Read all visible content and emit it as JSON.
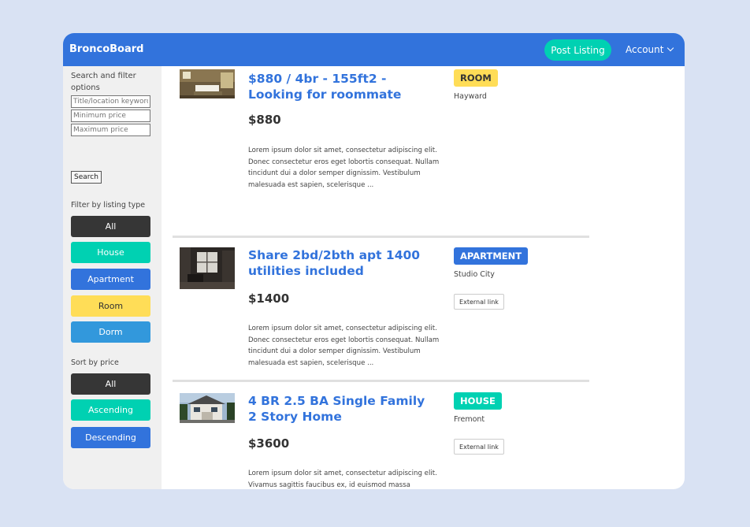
{
  "nav": {
    "brand": "BroncoBoard",
    "post_listing": "Post Listing",
    "account": "Account"
  },
  "sidebar": {
    "search_title": "Search and filter options",
    "title_placeholder": "Title/location keyword",
    "min_placeholder": "Minimum price",
    "max_placeholder": "Maximum price",
    "search_button": "Search",
    "filter_label": "Filter by listing type",
    "types": [
      {
        "label": "All",
        "color": "#363636"
      },
      {
        "label": "House",
        "color": "#00d1b2"
      },
      {
        "label": "Apartment",
        "color": "#3273dc"
      },
      {
        "label": "Room",
        "color": "#ffdd57"
      },
      {
        "label": "Dorm",
        "color": "#3298dc"
      }
    ],
    "sort_label": "Sort by price",
    "sorts": [
      {
        "label": "All",
        "color": "#363636"
      },
      {
        "label": "Ascending",
        "color": "#00d1b2"
      },
      {
        "label": "Descending",
        "color": "#3273dc"
      }
    ]
  },
  "listings": [
    {
      "title": "$880 / 4br - 155ft2 - Looking for roommate",
      "price": "$880",
      "description": "Lorem ipsum dolor sit amet, consectetur adipiscing elit. Donec consectetur eros eget lobortis consequat. Nullam tincidunt dui a dolor semper dignissim. Vestibulum malesuada est sapien, scelerisque ...",
      "tag": "ROOM",
      "tag_color": "#ffdd57",
      "location": "Hayward",
      "image": "bedroom-photo"
    },
    {
      "title": "Share 2bd/2bth apt 1400 utilities included",
      "price": "$1400",
      "description": "Lorem ipsum dolor sit amet, consectetur adipiscing elit. Donec consectetur eros eget lobortis consequat. Nullam tincidunt dui a dolor semper dignissim. Vestibulum malesuada est sapien, scelerisque ...",
      "tag": "APARTMENT",
      "tag_color": "#3273dc",
      "location": "Studio City",
      "external_link": "External link",
      "image": "living-room-photo"
    },
    {
      "title": "4 BR 2.5 BA Single Family 2 Story Home",
      "price": "$3600",
      "description": "Lorem ipsum dolor sit amet, consectetur adipiscing elit. Vivamus sagittis faucibus ex, id euismod massa hendrerit eu. Quisque nulla nisi, sollicitudin ut viverra id, dapibus volutpat est. Class apt...",
      "tag": "HOUSE",
      "tag_color": "#00d1b2",
      "location": "Fremont",
      "external_link": "External link",
      "image": "house-exterior-photo"
    }
  ]
}
